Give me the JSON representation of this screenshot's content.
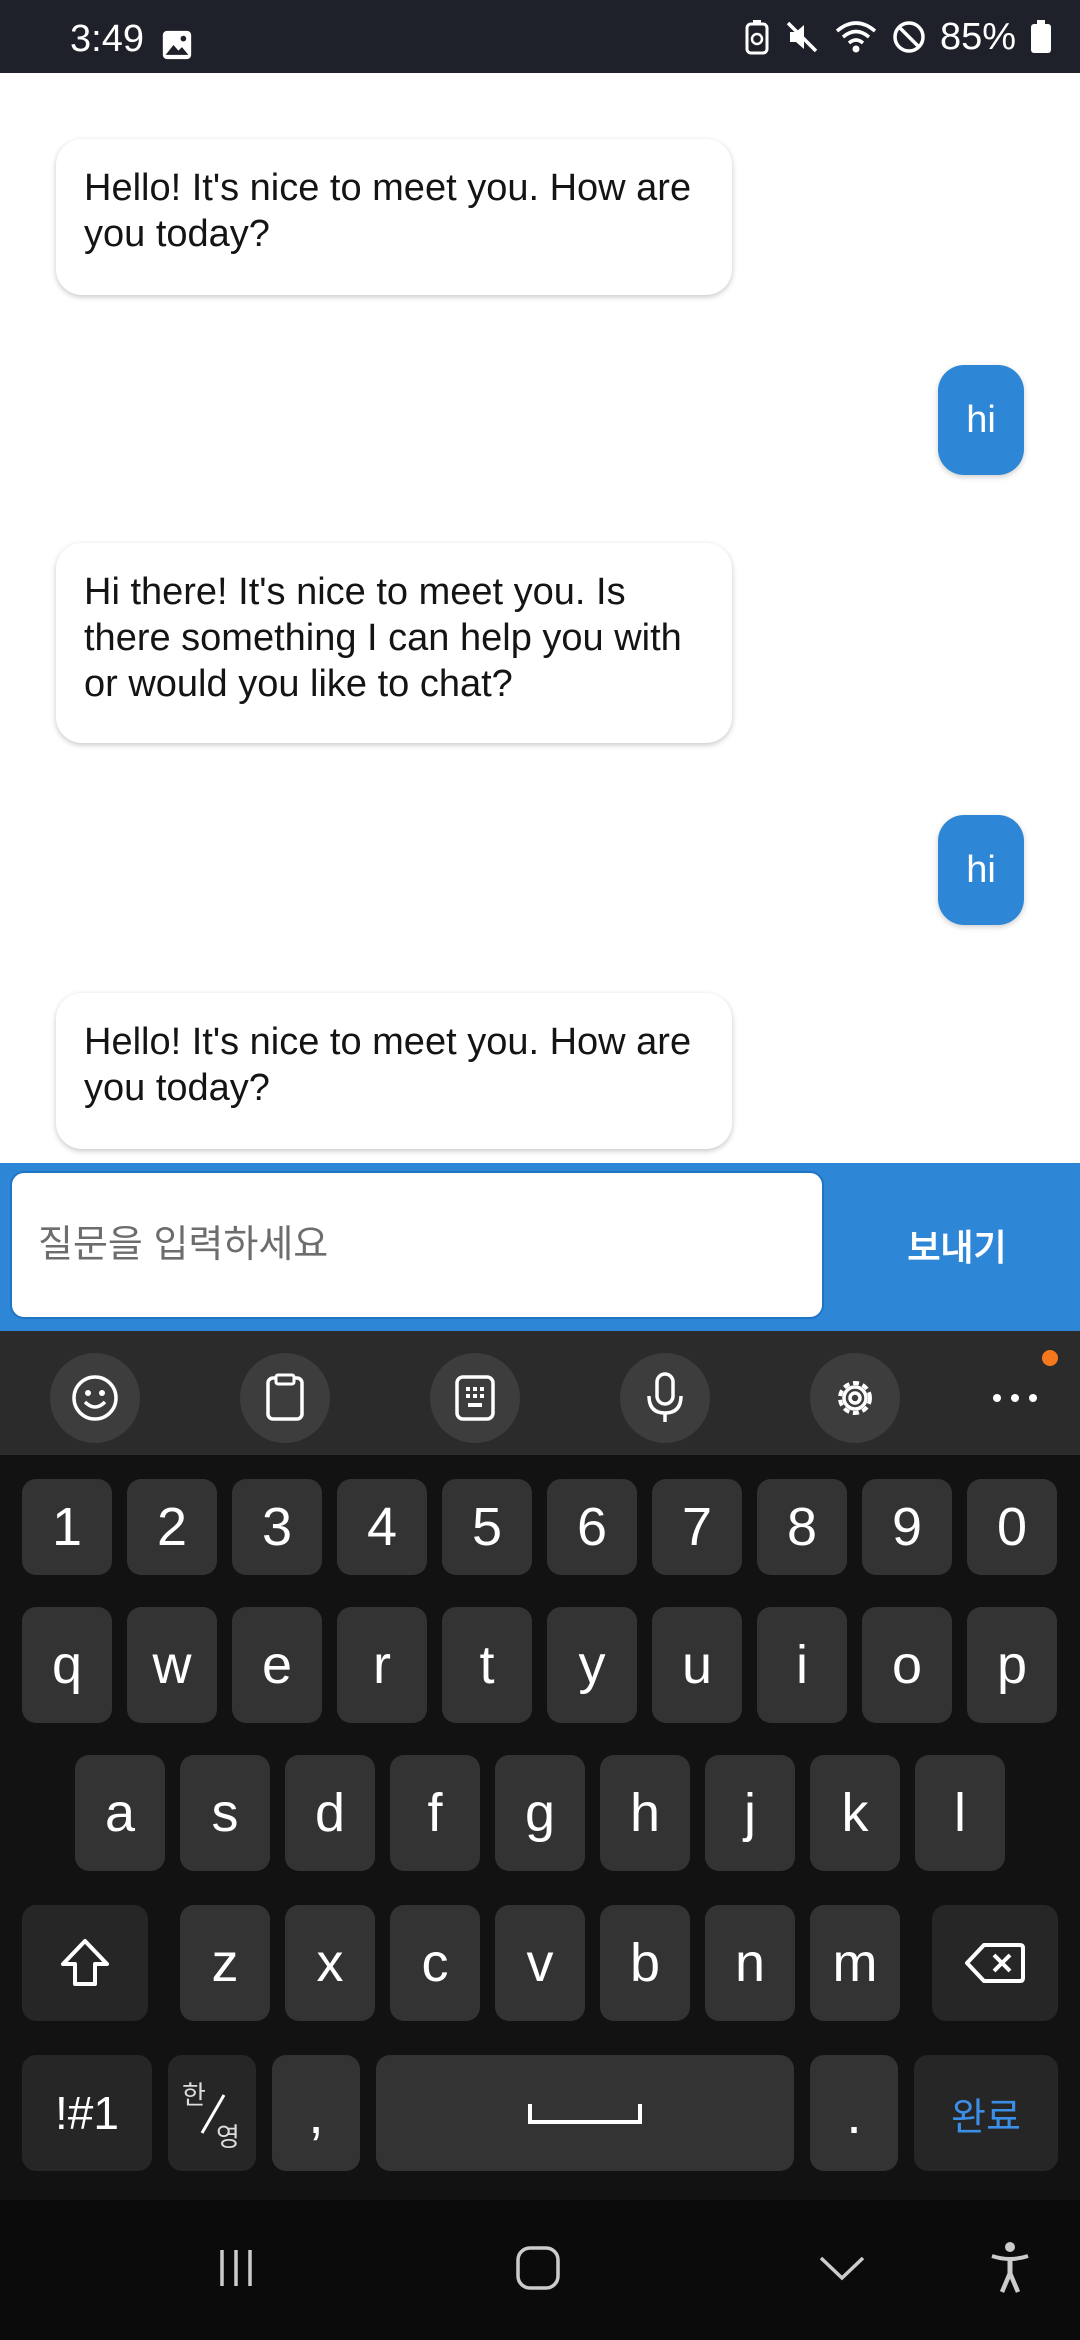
{
  "status_bar": {
    "time": "3:49",
    "battery_percent": "85%"
  },
  "messages": [
    {
      "sender": "bot",
      "text": "Hello! It's nice to meet you. How are you today?"
    },
    {
      "sender": "user",
      "text": "hi"
    },
    {
      "sender": "bot",
      "text": "Hi there! It's nice to meet you. Is there something I can help you with or would you like to chat?"
    },
    {
      "sender": "user",
      "text": "hi"
    },
    {
      "sender": "bot",
      "text": "Hello! It's nice to meet you. How are you today?"
    }
  ],
  "composer": {
    "placeholder": "질문을 입력하세요",
    "value": "",
    "send_label": "보내기"
  },
  "keyboard": {
    "toolbar_icons": [
      "emoji-icon",
      "clipboard-icon",
      "keyboard-layout-icon",
      "microphone-icon",
      "settings-icon",
      "more-icon"
    ],
    "number_row": [
      "1",
      "2",
      "3",
      "4",
      "5",
      "6",
      "7",
      "8",
      "9",
      "0"
    ],
    "row1": [
      "q",
      "w",
      "e",
      "r",
      "t",
      "y",
      "u",
      "i",
      "o",
      "p"
    ],
    "row2": [
      "a",
      "s",
      "d",
      "f",
      "g",
      "h",
      "j",
      "k",
      "l"
    ],
    "row3": [
      "z",
      "x",
      "c",
      "v",
      "b",
      "n",
      "m"
    ],
    "symbols_label": "!#1",
    "lang_top": "한",
    "lang_bottom": "영",
    "comma": ",",
    "period": ".",
    "done_label": "완료"
  },
  "colors": {
    "accent": "#2e86d6",
    "status_bar": "#1e2129",
    "keyboard_bg": "#121212",
    "key_bg": "#333333",
    "notification_dot": "#f5781f",
    "done_text": "#3b8fe6"
  },
  "nav_bar": {
    "icons": [
      "recent-apps-icon",
      "home-icon",
      "back-icon",
      "accessibility-icon"
    ]
  }
}
